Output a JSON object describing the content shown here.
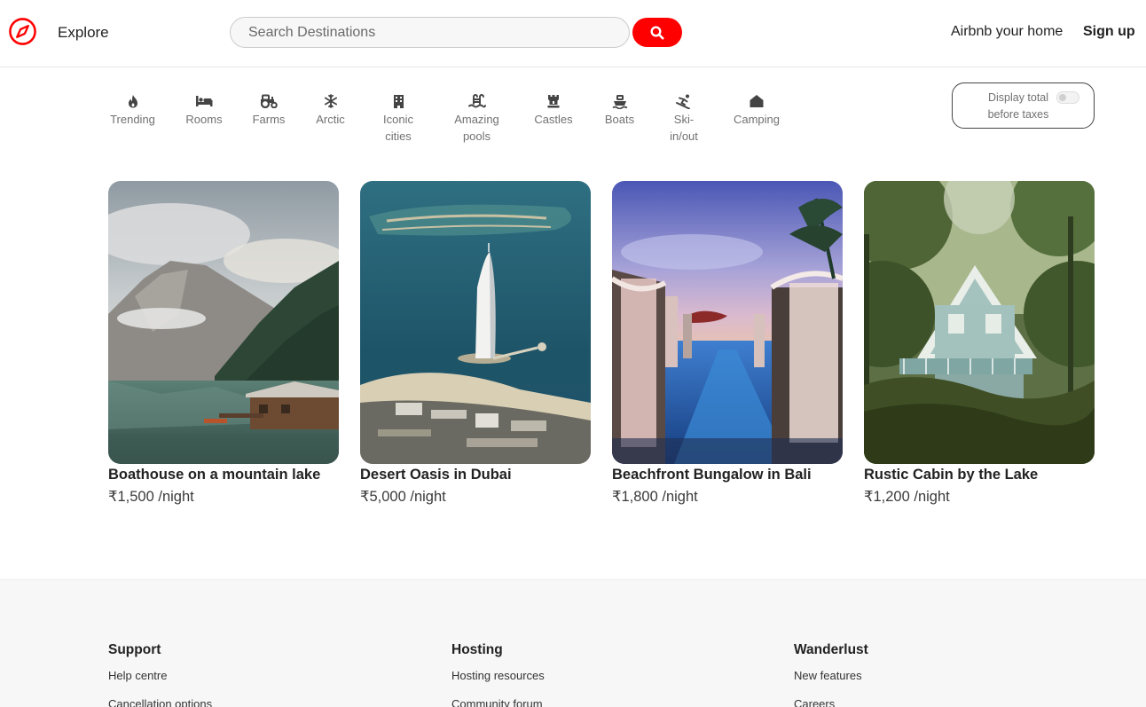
{
  "nav": {
    "explore_label": "Explore",
    "search_placeholder": "Search Destinations",
    "host_label": "Airbnb your home",
    "signup_label": "Sign up",
    "accent_color": "#ff0000"
  },
  "filters": [
    {
      "label": "Trending",
      "icon": "fire-icon"
    },
    {
      "label": "Rooms",
      "icon": "bed-icon"
    },
    {
      "label": "Farms",
      "icon": "tractor-icon"
    },
    {
      "label": "Arctic",
      "icon": "snowflake-icon"
    },
    {
      "label": "Iconic\ncities",
      "icon": "city-building-icon"
    },
    {
      "label": "Amazing\npools",
      "icon": "pool-icon"
    },
    {
      "label": "Castles",
      "icon": "castle-icon"
    },
    {
      "label": "Boats",
      "icon": "ship-icon"
    },
    {
      "label": "Ski-\nin/out",
      "icon": "skiing-icon"
    },
    {
      "label": "Camping",
      "icon": "campground-icon"
    }
  ],
  "tax_toggle": {
    "label": "Display total before taxes",
    "enabled": false
  },
  "listings": [
    {
      "title": "Boathouse on a mountain lake",
      "price": "₹1,500 /night",
      "image": "mountain-lake-boathouse-photo"
    },
    {
      "title": "Desert Oasis in Dubai",
      "price": "₹5,000 /night",
      "image": "dubai-burj-al-arab-aerial-photo"
    },
    {
      "title": "Beachfront Bungalow in Bali",
      "price": "₹1,800 /night",
      "image": "bali-infinity-pool-cabanas-photo"
    },
    {
      "title": "Rustic Cabin by the Lake",
      "price": "₹1,200 /night",
      "image": "cabin-in-forest-photo"
    }
  ],
  "footer": {
    "columns": [
      {
        "heading": "Support",
        "links": [
          "Help centre",
          "Cancellation options"
        ]
      },
      {
        "heading": "Hosting",
        "links": [
          "Hosting resources",
          "Community forum"
        ]
      },
      {
        "heading": "Wanderlust",
        "links": [
          "New features",
          "Careers"
        ]
      }
    ]
  }
}
